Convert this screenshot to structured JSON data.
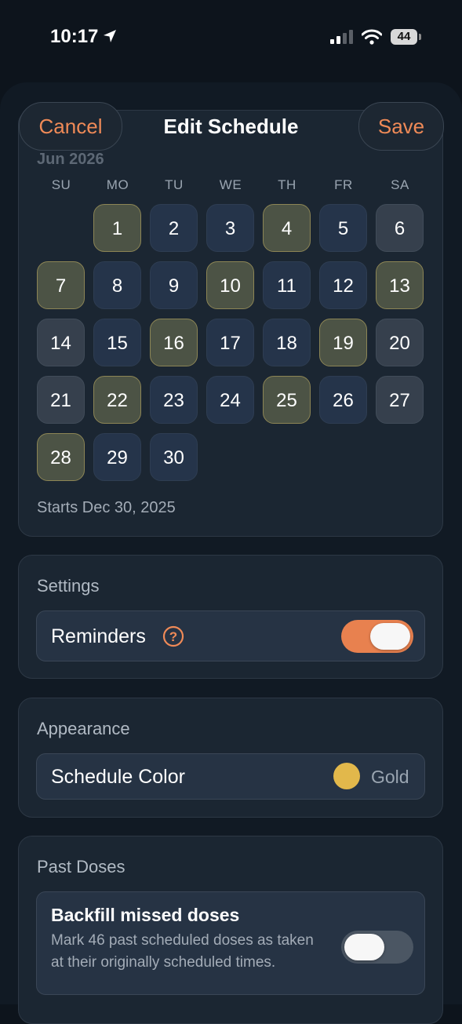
{
  "status": {
    "time": "10:17",
    "battery": "44"
  },
  "header": {
    "cancel_label": "Cancel",
    "title": "Edit Schedule",
    "save_label": "Save"
  },
  "calendar": {
    "month": "Jun 2026",
    "weekdays": [
      "SU",
      "MO",
      "TU",
      "WE",
      "TH",
      "FR",
      "SA"
    ],
    "days": [
      "1",
      "2",
      "3",
      "4",
      "5",
      "6",
      "7",
      "8",
      "9",
      "10",
      "11",
      "12",
      "13",
      "14",
      "15",
      "16",
      "17",
      "18",
      "19",
      "20",
      "21",
      "22",
      "23",
      "24",
      "25",
      "26",
      "27",
      "28",
      "29",
      "30"
    ],
    "scheduled_days": [
      1,
      4,
      7,
      10,
      13,
      16,
      19,
      22,
      25,
      28
    ],
    "starts_text": "Starts Dec 30, 2025"
  },
  "settings": {
    "title": "Settings",
    "reminders_label": "Reminders",
    "reminders_on": true
  },
  "appearance": {
    "title": "Appearance",
    "color_label": "Schedule Color",
    "color_value": "Gold",
    "color_hex": "#e2b84b"
  },
  "past_doses": {
    "title": "Past Doses",
    "backfill_title": "Backfill missed doses",
    "backfill_desc": "Mark 46 past scheduled doses as taken at their originally scheduled times.",
    "backfill_on": false
  },
  "colors": {
    "accent": "#ef8a57",
    "toggle_on": "#e8814f"
  }
}
